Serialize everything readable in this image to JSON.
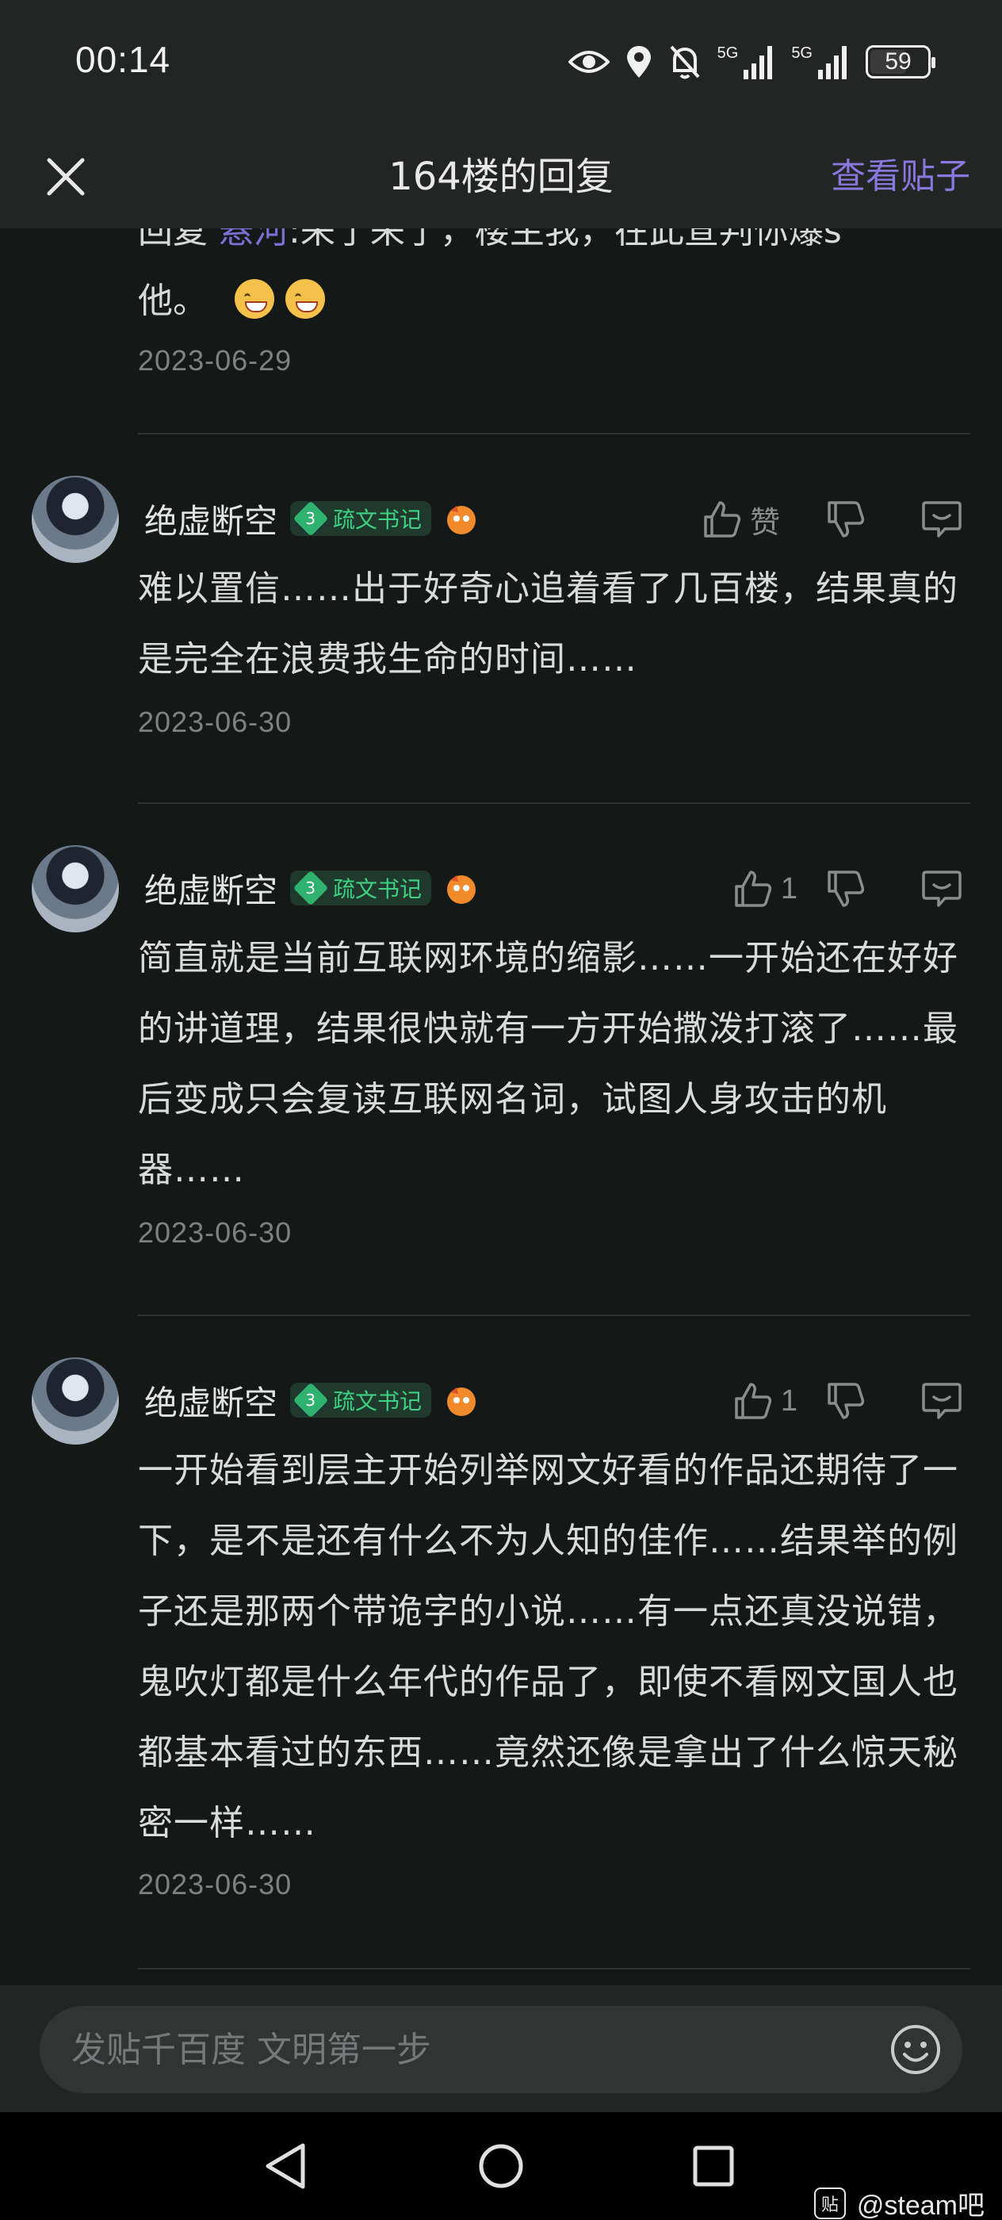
{
  "status": {
    "time": "00:14",
    "battery": "59",
    "net1": "5G",
    "net2": "5G"
  },
  "header": {
    "title": "164楼的回复",
    "view_post": "查看贴子"
  },
  "top_reply": {
    "prefix": "回复 ",
    "mention": "悬河",
    "text_line1": ":来了来了，楼主我，在此宣判你爆s",
    "text_line2": "他。",
    "date": "2023-06-29"
  },
  "comments": [
    {
      "username": "绝虚断空",
      "level": "3",
      "level_name": "疏文书记",
      "like_label": "赞",
      "text": "难以置信……出于好奇心追着看了几百楼，结果真的是完全在浪费我生命的时间……",
      "date": "2023-06-30"
    },
    {
      "username": "绝虚断空",
      "level": "3",
      "level_name": "疏文书记",
      "like_label": "1",
      "text": "简直就是当前互联网环境的缩影……一开始还在好好的讲道理，结果很快就有一方开始撒泼打滚了……最后变成只会复读互联网名词，试图人身攻击的机器……",
      "date": "2023-06-30"
    },
    {
      "username": "绝虚断空",
      "level": "3",
      "level_name": "疏文书记",
      "like_label": "1",
      "text": "一开始看到层主开始列举网文好看的作品还期待了一下，是不是还有什么不为人知的佳作……结果举的例子还是那两个带诡字的小说……有一点还真没说错，鬼吹灯都是什么年代的作品了，即使不看网文国人也都基本看过的东西……竟然还像是拿出了什么惊天秘密一样……",
      "date": "2023-06-30"
    }
  ],
  "input": {
    "placeholder": "发贴千百度 文明第一步"
  },
  "watermark": {
    "logo": "贴",
    "text": "@steam吧"
  },
  "colors": {
    "accent": "#8877dd",
    "level_green": "#2fb170",
    "background": "#141816"
  }
}
